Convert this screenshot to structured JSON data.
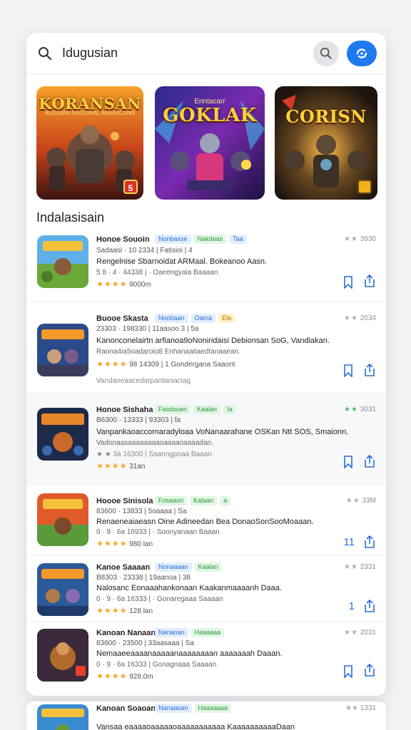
{
  "search": {
    "query": "Idugusian"
  },
  "icons": {
    "search": "search-icon",
    "voice": "voice-search-icon",
    "bookmark": "bookmark-icon",
    "share": "share-icon"
  },
  "colors": {
    "accent": "#1f7af0",
    "star": "#f5a623",
    "tag_green": "#2a9a3c",
    "tag_blue": "#2a6fd6"
  },
  "featured": [
    {
      "title": "KORANSAN",
      "subtitle": "RUSSIAN NATIONAL AMERICANS",
      "badge": "5"
    },
    {
      "title": "GOKLAK",
      "subtitle": "Enntacarr",
      "badge": ""
    },
    {
      "title": "CORISN",
      "subtitle": "",
      "badge": ""
    }
  ],
  "section": {
    "title": "Indalasisain"
  },
  "apps": [
    {
      "name": "Honoe Souoin",
      "tags": [
        "Nonbasse",
        "Nakdaas",
        "Taa"
      ],
      "meta": "Sadaasi · 10 2334 | Fatisioi | 4",
      "desc": "Rengelnise Sbarnoidat ARMaal. Bokeanoo Aasn.",
      "sub": "5 8 · 4 · 44338 | · Oaeengyaia Baaaan",
      "stars": "★★★★",
      "stars_text": "9000m",
      "note": "",
      "rating_stars": "★★",
      "rating": "3930",
      "act_count": ""
    },
    {
      "name": "Buooe Skasta",
      "tags": [
        "Noobaan",
        "Oama",
        "Ela"
      ],
      "meta": "23303 · 198330 | 11aasoo 3 | 5a",
      "desc": "Kanonconelairtn arfianoa9oNoniridaisi Debionsan SoG, Vandiakan.",
      "sub": "Raona4ia5oadaroio8 Enhanaatiaedtanaaean.",
      "stars": "★★★★",
      "stars_text": "98 14309 | 1 Gondergana Saaont",
      "note": "Vandaneaacedarpantaniaciag",
      "rating_stars": "★★",
      "rating": "2034",
      "act_count": ""
    },
    {
      "name": "Honoe Sishaha",
      "tags": [
        "Fasdouen",
        "Kaalan",
        "Ia"
      ],
      "meta": "B6300 · 13333 | 93303 | fa",
      "desc": "Vanpankaoaccornaradyloaa VoNanaarahane OSKan Ntt SOS, Smaionn.",
      "sub": "Vadonaasaaaaaaaaoaaaaoaaaadan.",
      "stars": "★★★★",
      "stars_text": "31an",
      "note": "★ ★ 3a 16300 | Saanngpoaa Baaan",
      "rating_stars": "★★",
      "rating": "3031",
      "act_count": ""
    },
    {
      "name": "Hoooe Sinisola",
      "tags": [
        "Fosaaon",
        "Kalaan",
        "a"
      ],
      "meta": "83600 · 13833 | 5oaaaa | Sa",
      "desc": "Renaeneaiaeasn Oine Adineedan Bea DonaoSonSooMoaaan.",
      "sub": "0 · 9 · 6a 16933 | · Soonyanaan Baaan",
      "stars": "★★★★",
      "stars_text": "980 lan",
      "note": "",
      "rating_stars": "★★",
      "rating": "33M",
      "act_count": "11"
    },
    {
      "name": "Kanoe Saaaan",
      "tags": [
        "Nonaaaan",
        "Kaalan"
      ],
      "meta": "B8303 · 23338 | 19aanoa | 38",
      "desc": "Nalosanc Eonaaahankonaan Kaakanmaaaanh Daaa.",
      "sub": "0 · 9 · 6a 16333 | · Gonaregaaa Saaaan",
      "stars": "★★★★",
      "stars_text": "128 lan",
      "note": "",
      "rating_stars": "★★",
      "rating": "2331",
      "act_count": "1"
    },
    {
      "name": "Kanoan Nanaan",
      "tags": [
        "Nanaoan",
        "Haaaaaa"
      ],
      "meta": "83600 · 23500 | 33aasaaa | Sa",
      "desc": "Nemaaeeaaaanaaaaanaaaaaaaan aaaaaaah Daaan.",
      "sub": "0 · 9 · 6a 16333 | Gonagnaaa Saaaan",
      "stars": "★★★★",
      "stars_text": "928.0m",
      "note": "",
      "rating_stars": "★★",
      "rating": "2031",
      "act_count": ""
    }
  ],
  "peek": {
    "name": "Kanoan Soaoan",
    "tags": [
      "Nanaaoan",
      "Haaaaaaa"
    ],
    "desc": "Vansaa eaaaaoaaaaaoaaaaaaaaaaa KaaaaaaaaaaDaan",
    "rating": "1331"
  }
}
